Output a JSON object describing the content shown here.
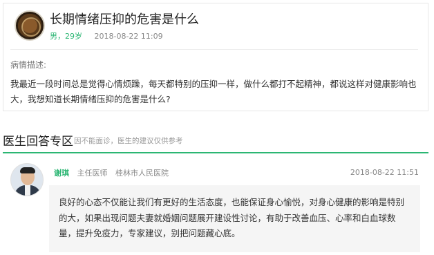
{
  "question": {
    "title": "长期情绪压抑的危害是什么",
    "gender_age": "男，29岁",
    "time": "2018-08-22 11:09",
    "description_label": "病情描述:",
    "description": "我最近一段时间总是觉得心情烦躁，每天都特别的压抑一样，做什么都打不起精神，都说这样对健康影响也大，我想知道长期情绪压抑的危害是什么?"
  },
  "section": {
    "title": "医生回答专区",
    "note": "因不能面诊，医生的建议仅供参考"
  },
  "answer": {
    "doctor_name": "谢琪",
    "doctor_title": "主任医师",
    "hospital": "桂林市人民医院",
    "time": "2018-08-22 11:51",
    "content": "良好的心态不仅能让我们有更好的生活态度，也能保证身心愉悦，对身心健康的影响是特别的大，如果出现问题夫妻就婚姻问题展开建设性讨论，有助于改善血压、心率和白血球数量，提升免疫力，专家建议，别把问题藏心底。"
  },
  "colors": {
    "accent": "#2bb673",
    "muted": "#888888",
    "bubble_bg": "#f5f5f5"
  }
}
